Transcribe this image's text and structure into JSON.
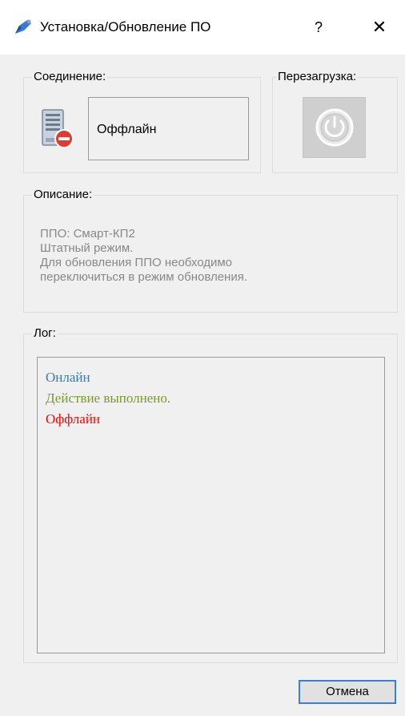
{
  "window": {
    "title": "Установка/Обновление ПО",
    "help_label": "?",
    "close_label": "✕"
  },
  "connection": {
    "legend": "Соединение:",
    "status": "Оффлайн"
  },
  "reboot": {
    "legend": "Перезагрузка:"
  },
  "description": {
    "legend": "Описание:",
    "lines": [
      "ППО: Смарт-КП2",
      "Штатный режим.",
      "Для обновления ППО необходимо",
      "переключиться в режим обновления."
    ]
  },
  "log": {
    "legend": "Лог:",
    "entries": [
      {
        "text": "Онлайн",
        "color": "#3a7ca5"
      },
      {
        "text": "Действие выполнено.",
        "color": "#7a9a2a"
      },
      {
        "text": "Оффлайн",
        "color": "#ff0000"
      }
    ]
  },
  "buttons": {
    "cancel_label": "Отмена"
  },
  "colors": {
    "accent": "#3c7fd1",
    "background": "#f0f0f0"
  }
}
